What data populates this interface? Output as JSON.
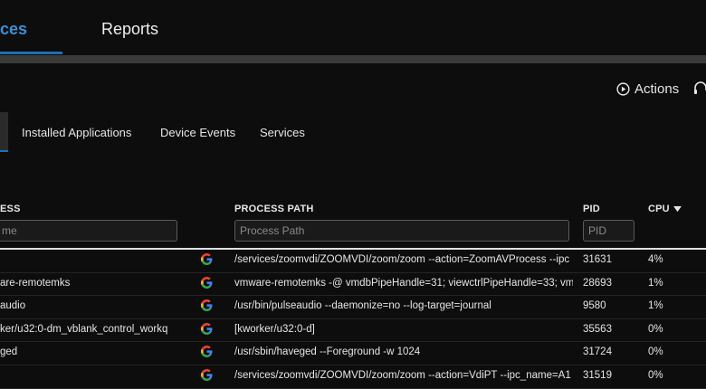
{
  "topnav": {
    "tabs": [
      {
        "label": "ces",
        "active": true
      },
      {
        "label": "Reports",
        "active": false
      }
    ],
    "accent_color": "#1f6fb5"
  },
  "toolbar": {
    "actions_label": "Actions",
    "actions_icon": "play-circle-icon",
    "support_icon": "headset-icon"
  },
  "subtabs": [
    {
      "label": "Installed Applications"
    },
    {
      "label": "Device Events"
    },
    {
      "label": "Services"
    }
  ],
  "table": {
    "columns": {
      "process": "ESS",
      "process_path": "PROCESS PATH",
      "pid": "PID",
      "cpu": "CPU"
    },
    "sort_icon": "caret-down-icon",
    "filters": {
      "process": {
        "value": "",
        "placeholder": "me"
      },
      "process_path": {
        "value": "",
        "placeholder": "Process Path"
      },
      "pid": {
        "value": "",
        "placeholder": "PID"
      }
    },
    "row_icon": "google-icon",
    "rows": [
      {
        "name": "",
        "path": "/services/zoomvdi/ZOOMVDI/zoom/zoom --action=ZoomAVProcess --ipc",
        "pid": "31631",
        "cpu": "4%"
      },
      {
        "name": "are-remotemks",
        "path": "vmware-remotemks -@ vmdbPipeHandle=31; viewctrlPipeHandle=33; vm",
        "pid": "28693",
        "cpu": "1%"
      },
      {
        "name": "audio",
        "path": "/usr/bin/pulseaudio --daemonize=no --log-target=journal",
        "pid": "9580",
        "cpu": "1%"
      },
      {
        "name": "ker/u32:0-dm_vblank_control_workq",
        "path": "[kworker/u32:0-d]",
        "pid": "35563",
        "cpu": "0%"
      },
      {
        "name": "ged",
        "path": "/usr/sbin/haveged --Foreground -w 1024",
        "pid": "31724",
        "cpu": "0%"
      },
      {
        "name": "",
        "path": "/services/zoomvdi/ZOOMVDI/zoom/zoom --action=VdiPT --ipc_name=A1",
        "pid": "31519",
        "cpu": "0%"
      }
    ]
  }
}
